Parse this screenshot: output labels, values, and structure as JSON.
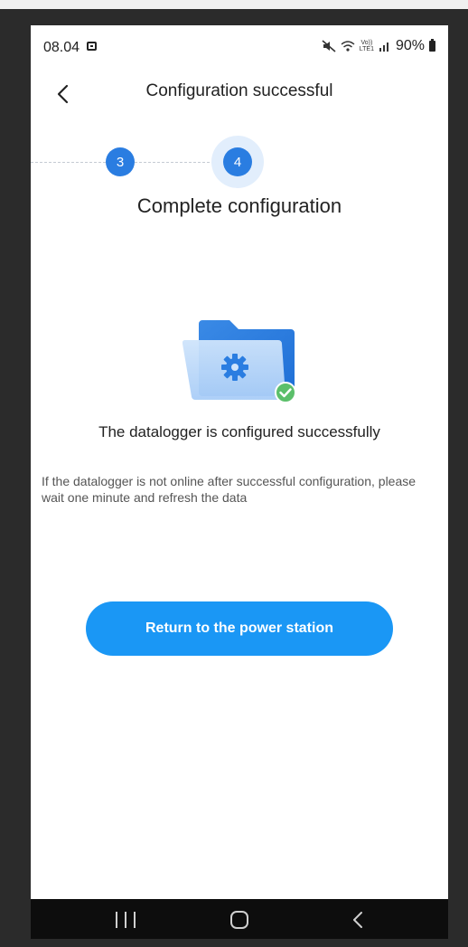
{
  "status_bar": {
    "time": "08.04",
    "battery": "90%",
    "network_label_top": "Vo))",
    "network_label_bottom": "LTE1"
  },
  "header": {
    "title": "Configuration successful",
    "back_icon": "chevron-left-icon"
  },
  "stepper": {
    "steps": [
      {
        "number": "3",
        "state": "done"
      },
      {
        "number": "4",
        "state": "active"
      }
    ],
    "active_label": "Complete configuration"
  },
  "illustration": {
    "icon": "folder-gear-check-icon",
    "colors": {
      "folder_back": "#2a7de1",
      "folder_front": "#bcd9fa",
      "gear": "#2a7de1",
      "check_badge": "#5bbf6a"
    }
  },
  "message": {
    "success": "The datalogger is configured successfully",
    "hint": "If the datalogger is not online after successful configuration, please wait one minute and refresh the data"
  },
  "actions": {
    "return_label": "Return to the power station",
    "button_color": "#1a97f5"
  },
  "navbar": {
    "recent_icon": "recent-apps-icon",
    "home_icon": "home-icon",
    "back_icon": "back-icon"
  }
}
